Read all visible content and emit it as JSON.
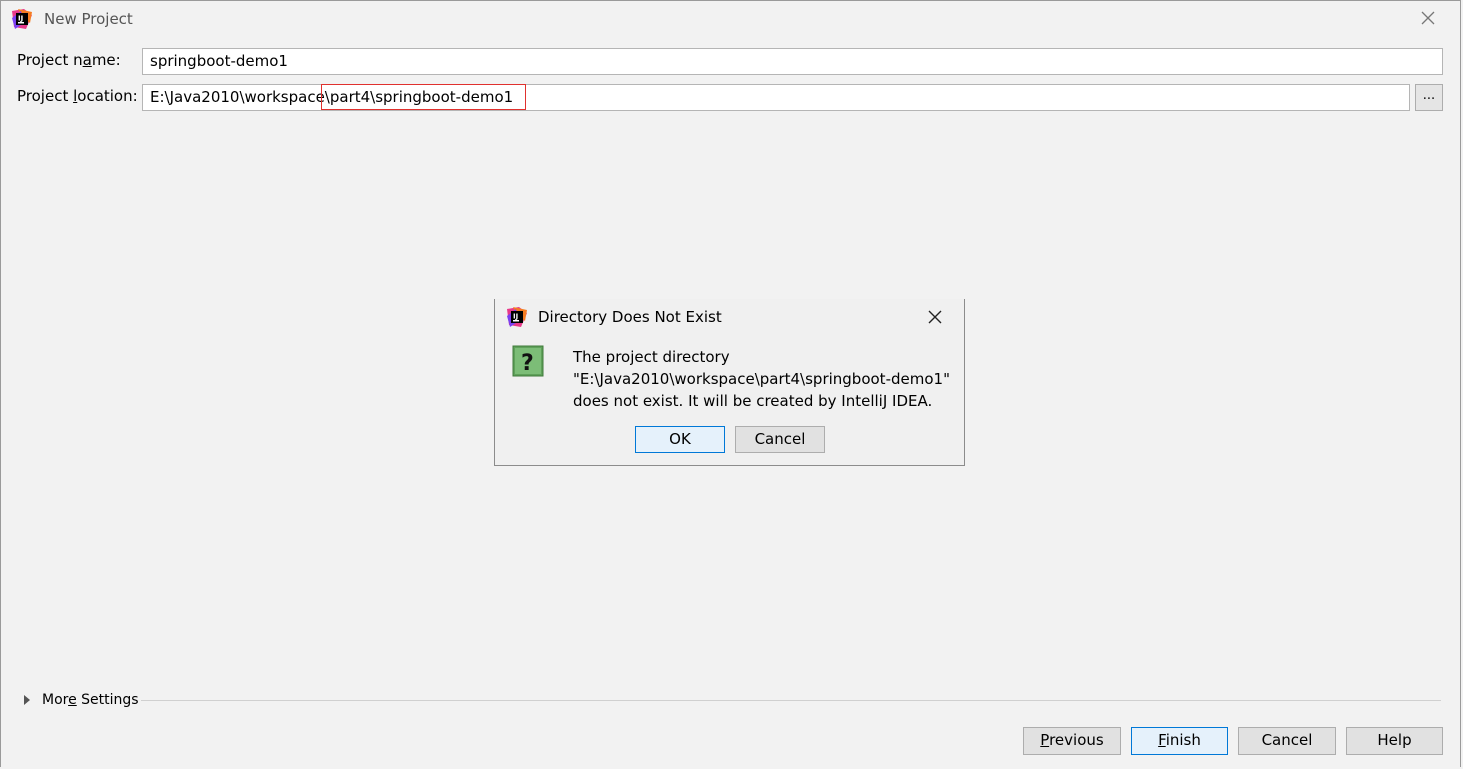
{
  "window": {
    "title": "New Project"
  },
  "form": {
    "project_name_label_pre": "Project n",
    "project_name_label_ul": "a",
    "project_name_label_post": "me:",
    "project_name_value": "springboot-demo1",
    "project_location_label_pre": "Project ",
    "project_location_label_ul": "l",
    "project_location_label_post": "ocation:",
    "project_location_value": "E:\\Java2010\\workspace\\part4\\springboot-demo1",
    "browse_label": "..."
  },
  "dialog": {
    "title": "Directory Does Not Exist",
    "message_line1": "The project directory",
    "message_line2": "\"E:\\Java2010\\workspace\\part4\\springboot-demo1\"",
    "message_line3": "does not exist. It will be created by IntelliJ IDEA.",
    "ok_label": "OK",
    "cancel_label": "Cancel"
  },
  "more_settings": {
    "label_pre": "Mor",
    "label_ul": "e",
    "label_post": " Settings"
  },
  "footer": {
    "previous_ul": "P",
    "previous_rest": "revious",
    "finish_ul": "F",
    "finish_rest": "inish",
    "cancel_label": "Cancel",
    "help_label": "Help"
  },
  "colors": {
    "highlight_box": "#e0312e",
    "primary_button_border": "#0078d7"
  }
}
